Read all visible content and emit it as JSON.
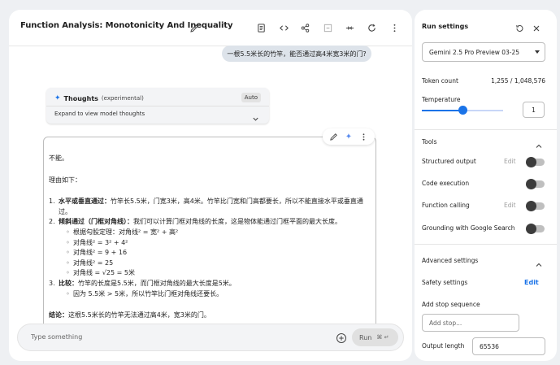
{
  "header": {
    "title": "Function Analysis: Monotonicity And Inequality"
  },
  "chat": {
    "user_message": "一根5.5米长的竹竿，能否通过高4米宽3米的门?",
    "thoughts": {
      "title": "Thoughts",
      "subtitle": "(experimental)",
      "auto_label": "Auto",
      "expand_label": "Expand to view model thoughts"
    },
    "response": {
      "line1": "不能。",
      "line2": "理由如下：",
      "items": [
        {
          "num": "1.",
          "bold": "水平或垂直通过：",
          "text": "竹竿长5.5米，门宽3米，高4米。竹竿比门宽和门高都要长，所以不能直接水平或垂直通",
          "cont": "过。"
        },
        {
          "num": "2.",
          "bold": "倾斜通过（门框对角线）：",
          "text": "我们可以计算门框对角线的长度，这是物体能通过门框平面的最大长度。",
          "subs": [
            "根据勾股定理：对角线² = 宽² + 高²",
            "对角线² = 3² + 4²",
            "对角线² = 9 + 16",
            "对角线² = 25",
            "对角线 = √25 = 5米"
          ]
        },
        {
          "num": "3.",
          "bold": "比较：",
          "text": "竹竿的长度是5.5米，而门框对角线的最大长度是5米。",
          "subs": [
            "因为 5.5米 > 5米，所以竹竿比门框对角线还要长。"
          ]
        }
      ],
      "conclusion_bold": "结论：",
      "conclusion_text": "这根5.5米长的竹竿无法通过高4米，宽3米的门。"
    }
  },
  "composer": {
    "placeholder": "Type something",
    "run_label": "Run",
    "run_shortcut": "⌘ ↵"
  },
  "settings": {
    "title": "Run settings",
    "model": "Gemini 2.5 Pro Preview 03-25",
    "token_count_label": "Token count",
    "token_count_value": "1,255 / 1,048,576",
    "temperature_label": "Temperature",
    "temperature_value": "1",
    "temperature_fraction": 0.5,
    "tools_label": "Tools",
    "structured_output": "Structured output",
    "code_execution": "Code execution",
    "function_calling": "Function calling",
    "grounding": "Grounding with Google Search",
    "edit_label": "Edit",
    "advanced_label": "Advanced settings",
    "safety_label": "Safety settings",
    "safety_edit": "Edit",
    "stop_sequence_label": "Add stop sequence",
    "stop_placeholder": "Add stop...",
    "output_length_label": "Output length",
    "output_length_value": "65536"
  }
}
